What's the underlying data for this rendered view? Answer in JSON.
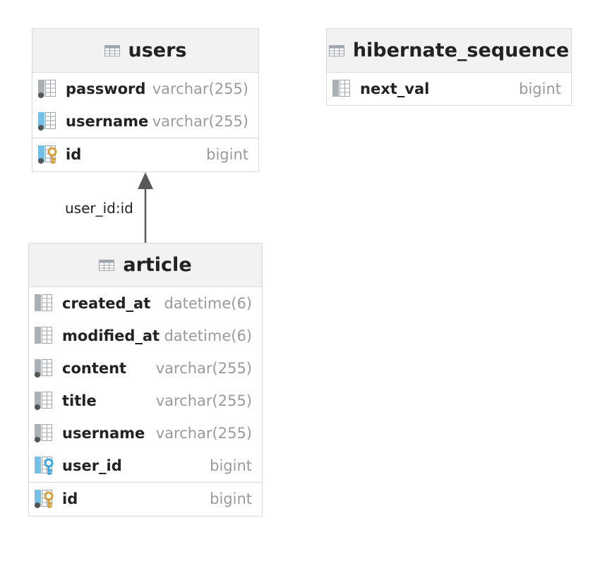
{
  "tables": {
    "users": {
      "name": "users",
      "columns": [
        {
          "name": "password",
          "type": "varchar(255)"
        },
        {
          "name": "username",
          "type": "varchar(255)"
        }
      ],
      "pk": {
        "name": "id",
        "type": "bigint"
      }
    },
    "hibernate_sequence": {
      "name": "hibernate_sequence",
      "columns": [
        {
          "name": "next_val",
          "type": "bigint"
        }
      ]
    },
    "article": {
      "name": "article",
      "columns": [
        {
          "name": "created_at",
          "type": "datetime(6)"
        },
        {
          "name": "modified_at",
          "type": "datetime(6)"
        },
        {
          "name": "content",
          "type": "varchar(255)"
        },
        {
          "name": "title",
          "type": "varchar(255)"
        },
        {
          "name": "username",
          "type": "varchar(255)"
        },
        {
          "name": "user_id",
          "type": "bigint"
        }
      ],
      "pk": {
        "name": "id",
        "type": "bigint"
      }
    }
  },
  "relation": {
    "label": "user_id:id"
  },
  "colors": {
    "pk_key": "#d4a03c",
    "fk_key": "#3aa6dc",
    "column_icon": "#9fa6ad",
    "line": "#5a5a5a"
  }
}
